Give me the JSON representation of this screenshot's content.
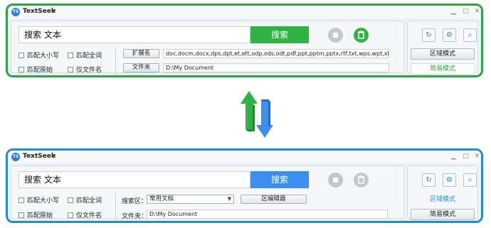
{
  "app": {
    "title": "TextSeek"
  },
  "top_window": {
    "search_value": "搜索  文本",
    "search_button": "搜索",
    "options": [
      "匹配大小写",
      "匹配全词",
      "匹配原始",
      "仅文件名"
    ],
    "ext_button": "扩展名",
    "ext_value": "doc,docm,docx,dps,dpt,et,ett,odp,ods,odt,pdf,ppt,pptm,pptx,rtf,txt,wps,wpt,xls,xlsm,xlsx",
    "folder_button": "文件夹",
    "folder_value": "D:\\My Document",
    "mode_area": "区域模式",
    "mode_simple": "简易模式"
  },
  "bottom_window": {
    "search_value": "搜索  文本",
    "search_button": "搜索",
    "options": [
      "匹配大小写",
      "匹配全词",
      "匹配原始",
      "仅文件名"
    ],
    "area_label": "搜索区：",
    "area_value": "常用文档",
    "area_editor_button": "区编辑器",
    "folder_label": "文件夹：",
    "folder_value": "D:\\My Document",
    "mode_area": "区域模式",
    "mode_simple": "简易模式"
  },
  "colors": {
    "top_accent": "#27a844",
    "bottom_accent": "#1e8fd6"
  },
  "icons": [
    "app-logo-icon",
    "chevron-down-icon",
    "minimize-icon",
    "maximize-icon",
    "close-icon",
    "stop-icon",
    "trash-icon",
    "refresh-icon",
    "gear-icon",
    "magnifier-icon",
    "swap-arrows-icon"
  ]
}
